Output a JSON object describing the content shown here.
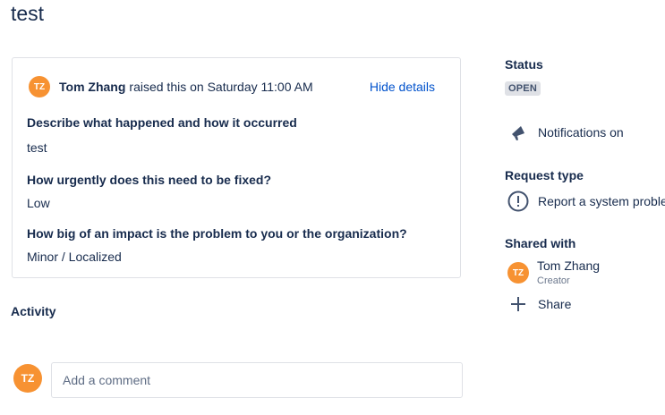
{
  "page": {
    "title": "test"
  },
  "request": {
    "reporter_initials": "TZ",
    "reporter_name": "Tom Zhang",
    "raised_text": "raised this on Saturday 11:00 AM",
    "hide_details": "Hide details",
    "fields": [
      {
        "label": "Describe what happened and how it occurred",
        "value": "test"
      },
      {
        "label": "How urgently does this need to be fixed?",
        "value": "Low"
      },
      {
        "label": "How big of an impact is the problem to you or the organization?",
        "value": "Minor / Localized"
      }
    ]
  },
  "activity": {
    "heading": "Activity",
    "avatar_initials": "TZ",
    "comment_placeholder": "Add a comment"
  },
  "sidebar": {
    "status_heading": "Status",
    "status_value": "OPEN",
    "notifications_label": "Notifications on",
    "request_type_heading": "Request type",
    "request_type_value": "Report a system proble",
    "shared_with_heading": "Shared with",
    "shared_user_initials": "TZ",
    "shared_user_name": "Tom Zhang",
    "shared_user_role": "Creator",
    "share_label": "Share"
  },
  "colors": {
    "avatar": "#f79232",
    "link": "#0052cc",
    "text": "#172b4d",
    "lozenge_bg": "#dfe1e6"
  },
  "icons": {
    "notifications": "megaphone-icon",
    "request_type": "exclamation-circle-icon",
    "share": "plus-icon"
  }
}
